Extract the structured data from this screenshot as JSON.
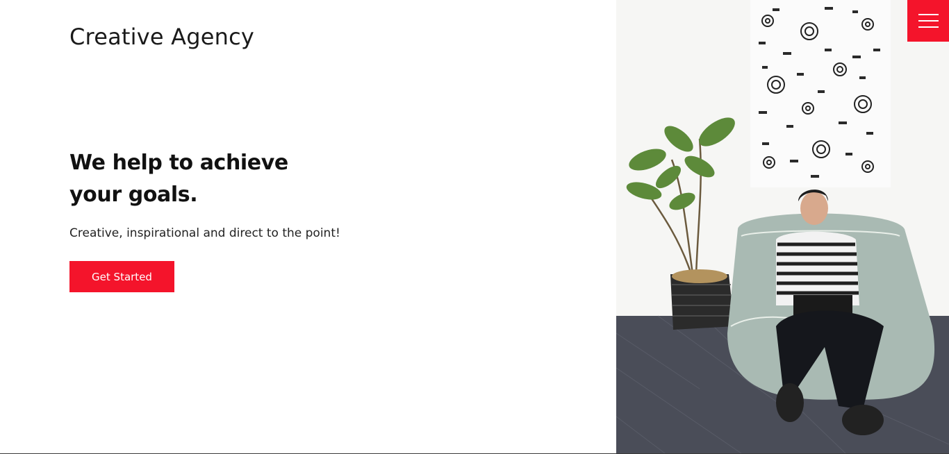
{
  "brand": {
    "logo_text": "Creative Agency"
  },
  "hero": {
    "headline_line1": "We help to achieve",
    "headline_line2": "your goals.",
    "subtitle": "Creative, inspirational and direct to the point!",
    "cta_label": "Get Started"
  },
  "menu": {
    "icon": "hamburger-menu-icon"
  },
  "colors": {
    "accent": "#f4142b",
    "text": "#111111",
    "background": "#ffffff"
  }
}
